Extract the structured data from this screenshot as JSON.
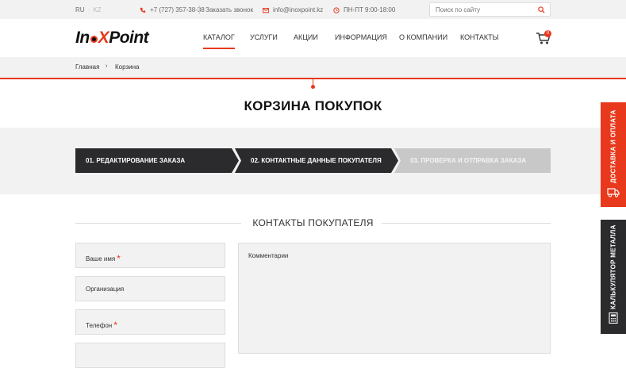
{
  "topbar": {
    "lang_active": "RU",
    "lang_inactive": "KZ",
    "phone": "+7 (727) 357-38-38",
    "callback": "Заказать звонок",
    "email": "info@inoxpoint.kz",
    "hours": "ПН-ПТ  9:00-18:00",
    "search_placeholder": "Поиск по сайту"
  },
  "header": {
    "logo_part1": "In",
    "logo_part2": "X",
    "logo_part3": "Point",
    "nav": [
      "КАТАЛОГ",
      "УСЛУГИ",
      "АКЦИИ",
      "ИНФОРМАЦИЯ",
      "О КОМПАНИИ",
      "КОНТАКТЫ"
    ],
    "cart_count": "0"
  },
  "breadcrumb": {
    "home": "Главная",
    "separator": "›",
    "current": "Корзина"
  },
  "page_title": "КОРЗИНА ПОКУПОК",
  "steps": [
    {
      "label": "01.  РЕДАКТИРОВАНИЕ ЗАКАЗА"
    },
    {
      "label": "02.  КОНТАКТНЫЕ ДАННЫЕ ПОКУПАТЕЛЯ"
    },
    {
      "label": "03.  ПРОВЕРКА И ОТПРАВКА ЗАКАЗА"
    }
  ],
  "section_title": "КОНТАКТЫ ПОКУПАТЕЛЯ",
  "form": {
    "name_label": "Ваше имя",
    "org_label": "Организация",
    "phone_label": "Телефон",
    "required_mark": "*",
    "comment_label": "Комментарии"
  },
  "side_tabs": {
    "delivery": "ДОСТАВКА И ОПЛАТА",
    "calculator": "КАЛЬКУЛЯТОР МЕТАЛЛА"
  },
  "colors": {
    "accent": "#e8391d",
    "dark": "#2b2b2e",
    "inactive_step": "#c8c8c8",
    "band": "#f2f2f2"
  }
}
